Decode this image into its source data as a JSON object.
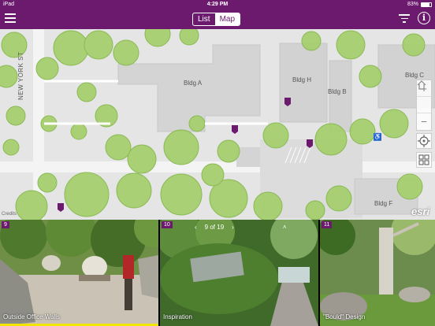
{
  "status": {
    "carrier": "iPad",
    "time": "4:29 PM",
    "battery": "83%",
    "battery_level": 0.83
  },
  "nav": {
    "list_label": "List",
    "map_label": "Map",
    "selected": "Map"
  },
  "map": {
    "buildings": [
      "Bldg A",
      "Bldg H",
      "Bldg B",
      "Bldg C",
      "Bldg F"
    ],
    "street": "NEW YORK ST",
    "zoom_in": "+",
    "zoom_out": "−",
    "credits": "Credits",
    "logo": "esri"
  },
  "tour": {
    "cards": [
      {
        "number": "9",
        "caption": "Outside Office Walls"
      },
      {
        "number": "10",
        "caption": "Inspiration"
      },
      {
        "number": "11",
        "caption": "\"Bould\" Design"
      }
    ],
    "pager": {
      "prev": "‹",
      "text": "9 of 19",
      "next": "›",
      "up": "˄"
    }
  },
  "colors": {
    "brand": "#6b1a6e",
    "highlight": "#f2e600"
  }
}
